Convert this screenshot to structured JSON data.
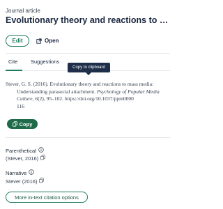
{
  "header": {
    "type_label": "Journal article",
    "title": "Evolutionary theory and reactions to mass m..."
  },
  "actions": {
    "edit_label": "Edit",
    "open_label": "Open"
  },
  "tabs": [
    {
      "label": "Cite",
      "active": true
    },
    {
      "label": "Suggestions",
      "active": false
    }
  ],
  "tooltip": {
    "text": "Copy to clipboard"
  },
  "citation": {
    "author_year": "Stever, G. S. (2016). Evolutionary theory and reactions to mass media:",
    "line2_plain": "Understanding parasocial attachment. ",
    "journal": "Psychology of Popular Media Culture",
    "after_journal": ", ",
    "volume": "6",
    "issue_pages": "(2), 95–102. https://doi.org/10.1037/ppm0000",
    "tail": "116"
  },
  "copy_button": {
    "label": "Copy"
  },
  "in_text": {
    "parenthetical_label": "Parenthetical",
    "parenthetical_value": "(Stever, 2016)",
    "narrative_label": "Narrative",
    "narrative_value": "Stever (2016)"
  },
  "more_button": {
    "label": "More in-text citation options"
  },
  "colors": {
    "accent_green": "#1f7a5a",
    "copy_button_bg": "#1d6b48",
    "tooltip_bg": "#1f2f4a",
    "title_text": "#1a2740"
  },
  "icons": {
    "open": "external-link-icon",
    "copy": "copy-icon",
    "info": "info-icon"
  }
}
